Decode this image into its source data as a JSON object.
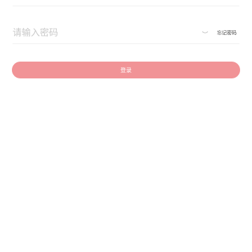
{
  "password_field": {
    "placeholder": "请输入密码",
    "value": ""
  },
  "toggle_visibility_icon": "eye-closed-icon",
  "forgot_password_label": "忘记密码",
  "login_button_label": "登录",
  "colors": {
    "accent": "#f19396",
    "divider": "#f1f1f1",
    "placeholder": "#c9c9c9"
  }
}
